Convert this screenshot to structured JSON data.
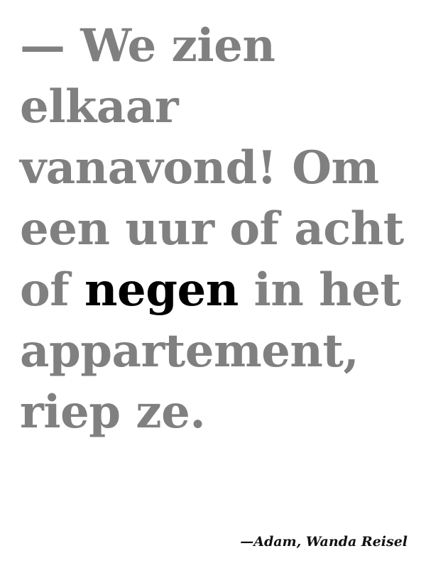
{
  "quote": {
    "lines": [
      "— We zien",
      "elkaar",
      "vanavond! Om",
      "een uur of acht",
      "of ",
      " in het",
      "appartement,",
      "riep ze."
    ],
    "highlight_word": "negen",
    "text_color": "#808080",
    "highlight_color": "#000000"
  },
  "attribution": {
    "text": "—Adam, Wanda Reisel"
  }
}
